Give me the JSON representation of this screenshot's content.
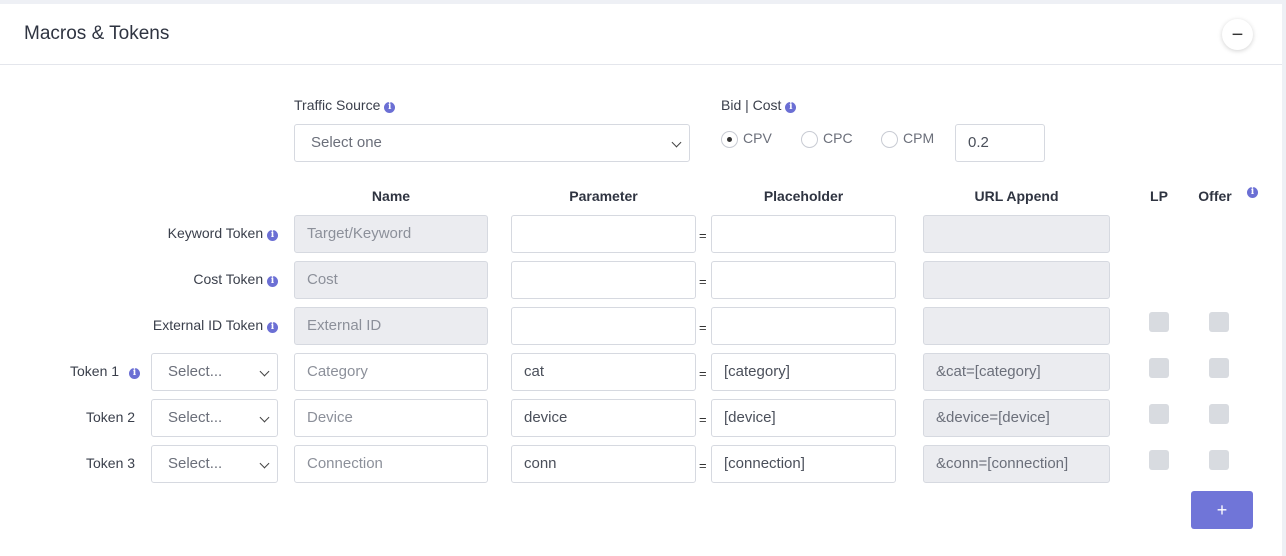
{
  "panel": {
    "title": "Macros & Tokens",
    "collapse_symbol": "−"
  },
  "traffic_source": {
    "label": "Traffic Source",
    "value": "Select one"
  },
  "bid_cost": {
    "label": "Bid | Cost",
    "options": [
      "CPV",
      "CPC",
      "CPM"
    ],
    "selected": "CPV",
    "value": "0.2"
  },
  "columns": {
    "name": "Name",
    "parameter": "Parameter",
    "placeholder": "Placeholder",
    "url_append": "URL Append",
    "lp": "LP",
    "offer": "Offer"
  },
  "equals": "=",
  "rows": [
    {
      "label": "Keyword Token",
      "name": "Target/Keyword",
      "parameter": "",
      "placeholder": "",
      "url_append": ""
    },
    {
      "label": "Cost Token",
      "name": "Cost",
      "parameter": "",
      "placeholder": "",
      "url_append": ""
    },
    {
      "label": "External ID Token",
      "name": "External ID",
      "parameter": "",
      "placeholder": "",
      "url_append": ""
    },
    {
      "label": "Token 1",
      "select": "Select...",
      "name": "Category",
      "parameter": "cat",
      "placeholder": "[category]",
      "url_append": "&cat=[category]"
    },
    {
      "label": "Token 2",
      "select": "Select...",
      "name": "Device",
      "parameter": "device",
      "placeholder": "[device]",
      "url_append": "&device=[device]"
    },
    {
      "label": "Token 3",
      "select": "Select...",
      "name": "Connection",
      "parameter": "conn",
      "placeholder": "[connection]",
      "url_append": "&conn=[connection]"
    }
  ],
  "add_button": "+",
  "icons": {
    "info": "info-icon",
    "collapse": "minus-icon",
    "dropdown": "chevron-down-icon"
  },
  "colors": {
    "accent": "#7075d8",
    "info": "#6b6fd4"
  }
}
